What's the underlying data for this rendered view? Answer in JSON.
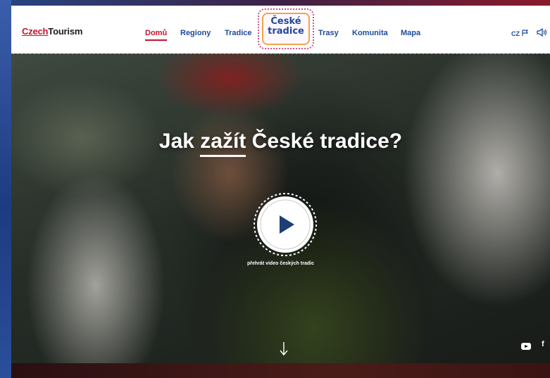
{
  "brand": {
    "part1": "Czech",
    "part2": "Tourism"
  },
  "nav": {
    "items": [
      {
        "label": "Domů",
        "active": true
      },
      {
        "label": "Regiony"
      },
      {
        "label": "Tradice"
      },
      {
        "label": "Trasy"
      },
      {
        "label": "Komunita"
      },
      {
        "label": "Mapa"
      }
    ]
  },
  "logo": {
    "line1": "České",
    "line2": "tradice"
  },
  "lang": {
    "code": "CZ",
    "icon": "flag-icon"
  },
  "hero": {
    "title_before": "Jak ",
    "title_em": "zažít",
    "title_after": " České tradice?",
    "play_label": "přehrát video českých tradic",
    "scroll_icon": "arrow-down-icon"
  },
  "social": [
    "youtube-icon",
    "facebook-icon"
  ],
  "colors": {
    "brand_red": "#c8102e",
    "nav_blue": "#1e4a9c"
  }
}
